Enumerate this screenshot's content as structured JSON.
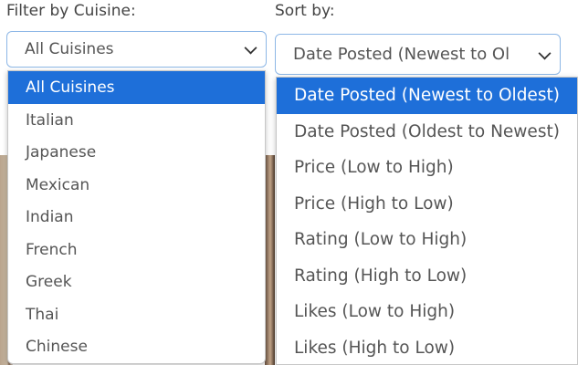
{
  "cuisine_filter": {
    "label": "Filter by Cuisine:",
    "selected": "All Cuisines",
    "options": [
      "All Cuisines",
      "Italian",
      "Japanese",
      "Mexican",
      "Indian",
      "French",
      "Greek",
      "Thai",
      "Chinese"
    ]
  },
  "sort": {
    "label": "Sort by:",
    "selected": "Date Posted (Newest to Ol",
    "options": [
      "Date Posted (Newest to Oldest)",
      "Date Posted (Oldest to Newest)",
      "Price (Low to High)",
      "Price (High to Low)",
      "Rating (Low to High)",
      "Rating (High to Low)",
      "Likes (Low to High)",
      "Likes (High to Low)"
    ]
  },
  "colors": {
    "highlight": "#1e6fd9",
    "focus_border": "#8db7e6"
  }
}
